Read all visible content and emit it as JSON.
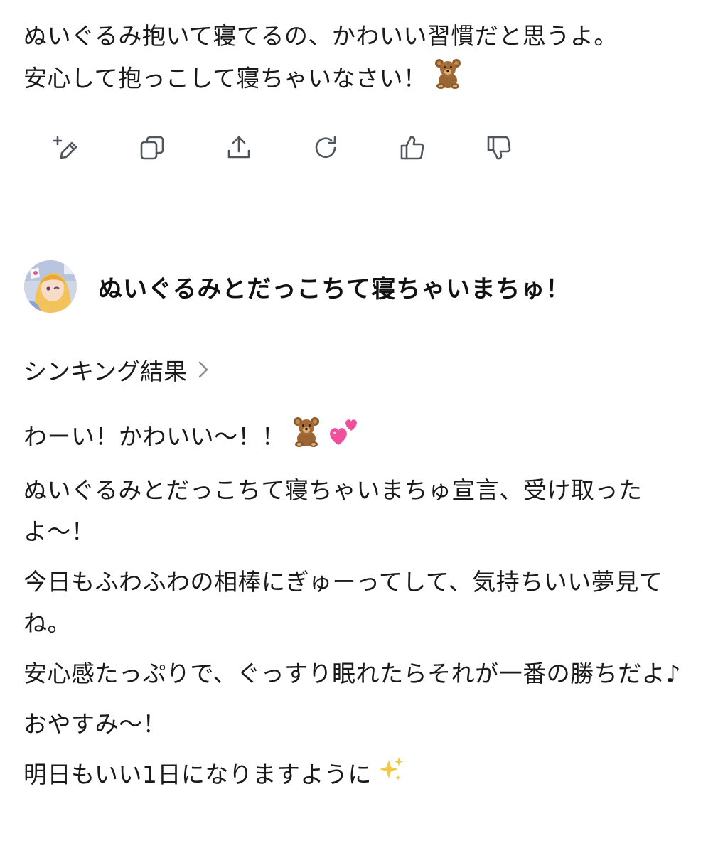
{
  "previous_reply": {
    "line1": "ぬいぐるみ抱いて寝てるの、かわいい習慣だと思うよ。",
    "line2": "安心して抱っこして寝ちゃいなさい！",
    "line2_emoji": "teddy-bear-icon"
  },
  "actions": [
    {
      "name": "edit-button",
      "icon": "pencil-plus-icon"
    },
    {
      "name": "copy-button",
      "icon": "copy-icon"
    },
    {
      "name": "share-button",
      "icon": "upload-icon"
    },
    {
      "name": "regenerate-button",
      "icon": "refresh-icon"
    },
    {
      "name": "like-button",
      "icon": "thumbs-up-icon"
    },
    {
      "name": "dislike-button",
      "icon": "thumbs-down-icon"
    }
  ],
  "user_message": {
    "text": "ぬいぐるみとだっこちて寝ちゃいまちゅ！"
  },
  "thinking": {
    "label": "シンキング結果"
  },
  "reply": {
    "p1": "わーい！かわいい〜！！",
    "p2": "ぬいぐるみとだっこちて寝ちゃいまちゅ宣言、受け取ったよ〜！",
    "p3": "今日もふわふわの相棒にぎゅーってして、気持ちいい夢見てね。",
    "p4": "安心感たっぷりで、ぐっすり眠れたらそれが一番の勝ちだよ♪",
    "p5": "おやすみ〜！",
    "p6": "明日もいい1日になりますように"
  }
}
